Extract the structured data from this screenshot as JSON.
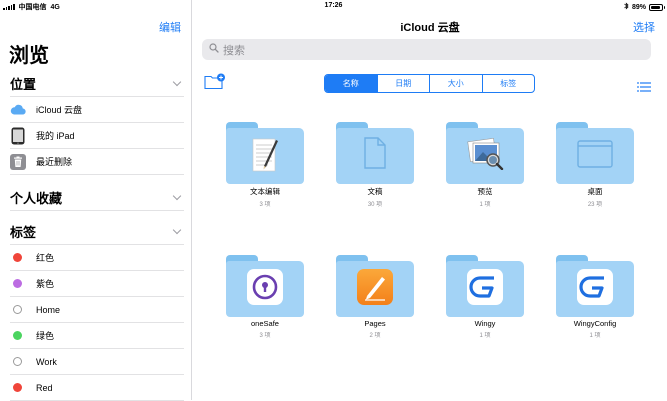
{
  "status": {
    "carrier": "中国电信",
    "network": "4G",
    "time": "17:26",
    "battery": "89%",
    "battery_level": 0.89
  },
  "sidebar": {
    "edit_label": "编辑",
    "title": "浏览",
    "locations": {
      "heading": "位置",
      "items": [
        {
          "label": "iCloud 云盘",
          "icon": "icloud-icon"
        },
        {
          "label": "我的 iPad",
          "icon": "ipad-icon"
        },
        {
          "label": "最近删除",
          "icon": "trash-icon"
        }
      ]
    },
    "favorites": {
      "heading": "个人收藏"
    },
    "tags": {
      "heading": "标签",
      "items": [
        {
          "label": "红色",
          "color": "#f0453a"
        },
        {
          "label": "紫色",
          "color": "#bc6ce2"
        },
        {
          "label": "Home",
          "color": "outline"
        },
        {
          "label": "绿色",
          "color": "#4bd460"
        },
        {
          "label": "Work",
          "color": "outline"
        },
        {
          "label": "Red",
          "color": "#f0453a"
        }
      ]
    }
  },
  "main": {
    "title": "iCloud 云盘",
    "select_label": "选择",
    "search_placeholder": "搜索",
    "sort_tabs": [
      {
        "label": "名称",
        "active": true
      },
      {
        "label": "日期",
        "active": false
      },
      {
        "label": "大小",
        "active": false
      },
      {
        "label": "标签",
        "active": false
      }
    ],
    "items": [
      {
        "name": "文本编辑",
        "count": "3 项",
        "icon": "textedit-icon"
      },
      {
        "name": "文稿",
        "count": "30 项",
        "icon": "document-icon"
      },
      {
        "name": "预览",
        "count": "1 项",
        "icon": "preview-icon"
      },
      {
        "name": "桌面",
        "count": "23 项",
        "icon": "desktop-icon"
      },
      {
        "name": "oneSafe",
        "count": "3 项",
        "icon": "onesafe-icon"
      },
      {
        "name": "Pages",
        "count": "2 项",
        "icon": "pages-icon"
      },
      {
        "name": "Wingy",
        "count": "1 项",
        "icon": "wingy-icon"
      },
      {
        "name": "WingyConfig",
        "count": "1 项",
        "icon": "wingy-icon"
      }
    ]
  }
}
